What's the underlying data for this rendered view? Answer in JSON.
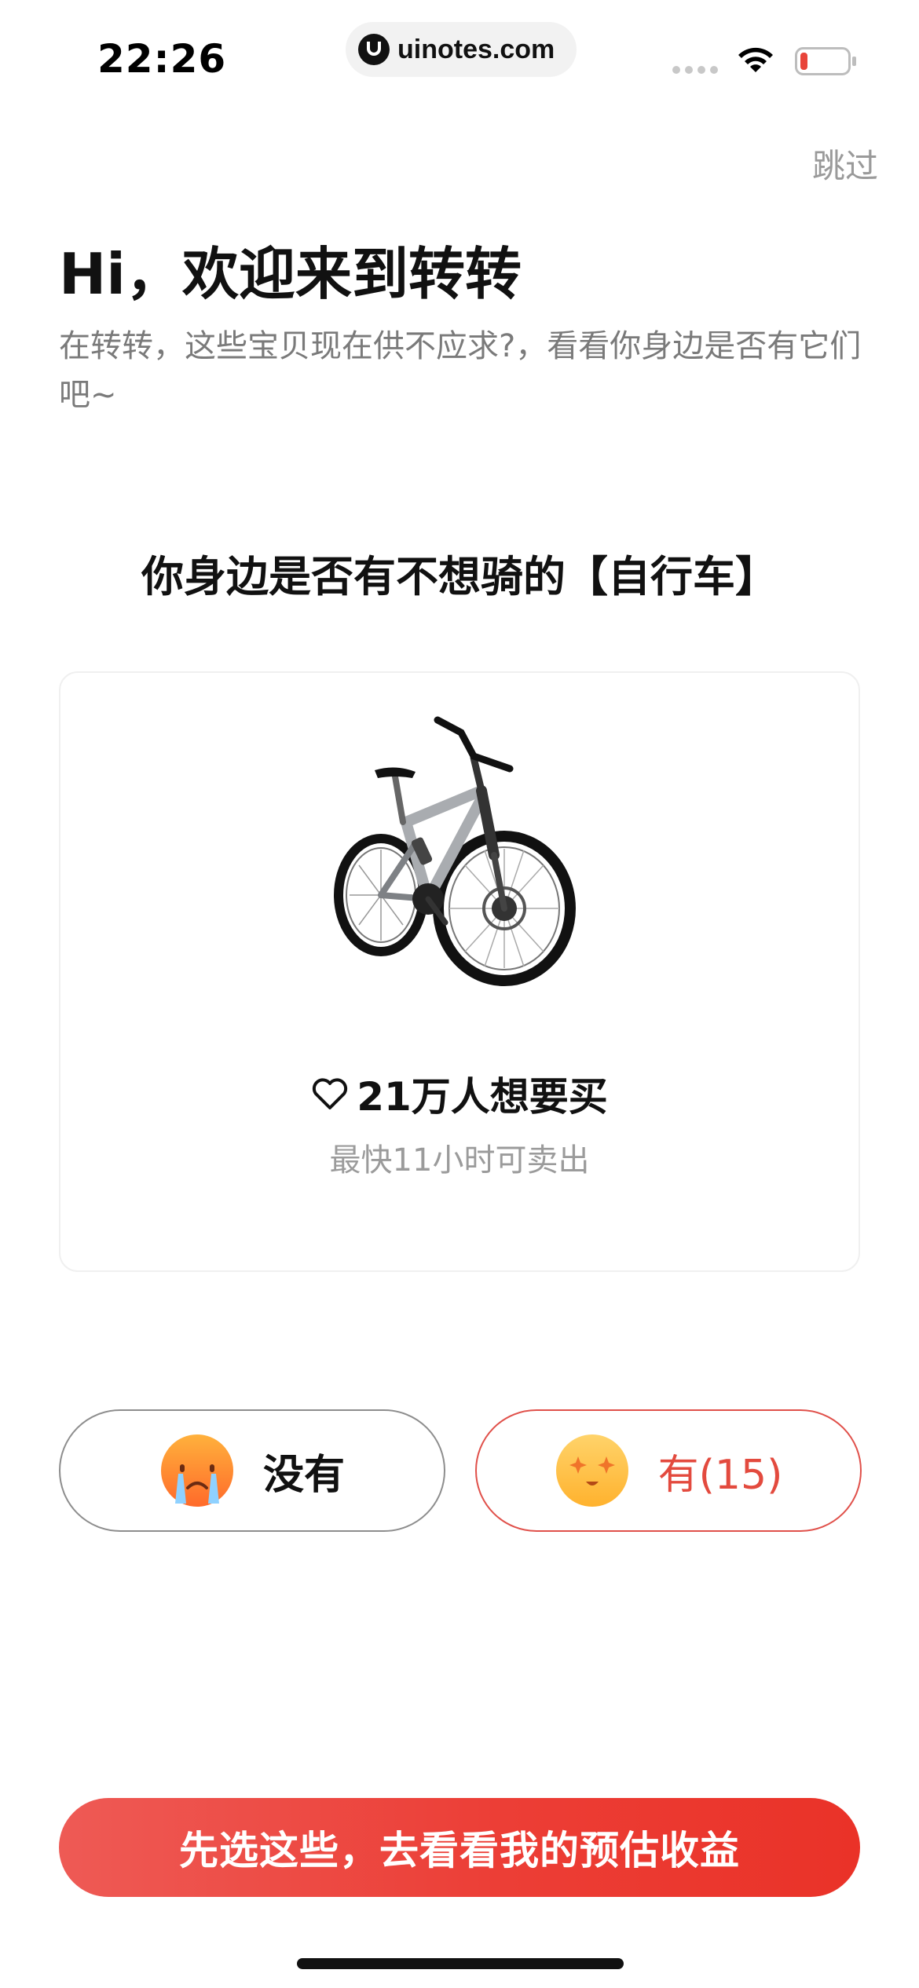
{
  "status_bar": {
    "time": "22:26",
    "url": "uinotes.com",
    "icons": [
      "signal-icon",
      "wifi-icon",
      "battery-low-icon"
    ]
  },
  "header": {
    "skip_label": "跳过",
    "greeting": "Hi，欢迎来到转转",
    "subtitle": "在转转，这些宝贝现在供不应求?，看看你身边是否有它们吧~"
  },
  "question": "你身边是否有不想骑的【自行车】",
  "item_card": {
    "image": "mountain-bike",
    "demand_text": "21万人想要买",
    "sell_time_text": "最快11小时可卖出"
  },
  "choices": {
    "no_label": "没有",
    "yes_label": "有(15)"
  },
  "cta": {
    "label": "先选这些，去看看我的预估收益"
  },
  "colors": {
    "accent": "#EC3E36",
    "yes_text": "#E34A3E",
    "muted_text": "#9B9B9B"
  }
}
